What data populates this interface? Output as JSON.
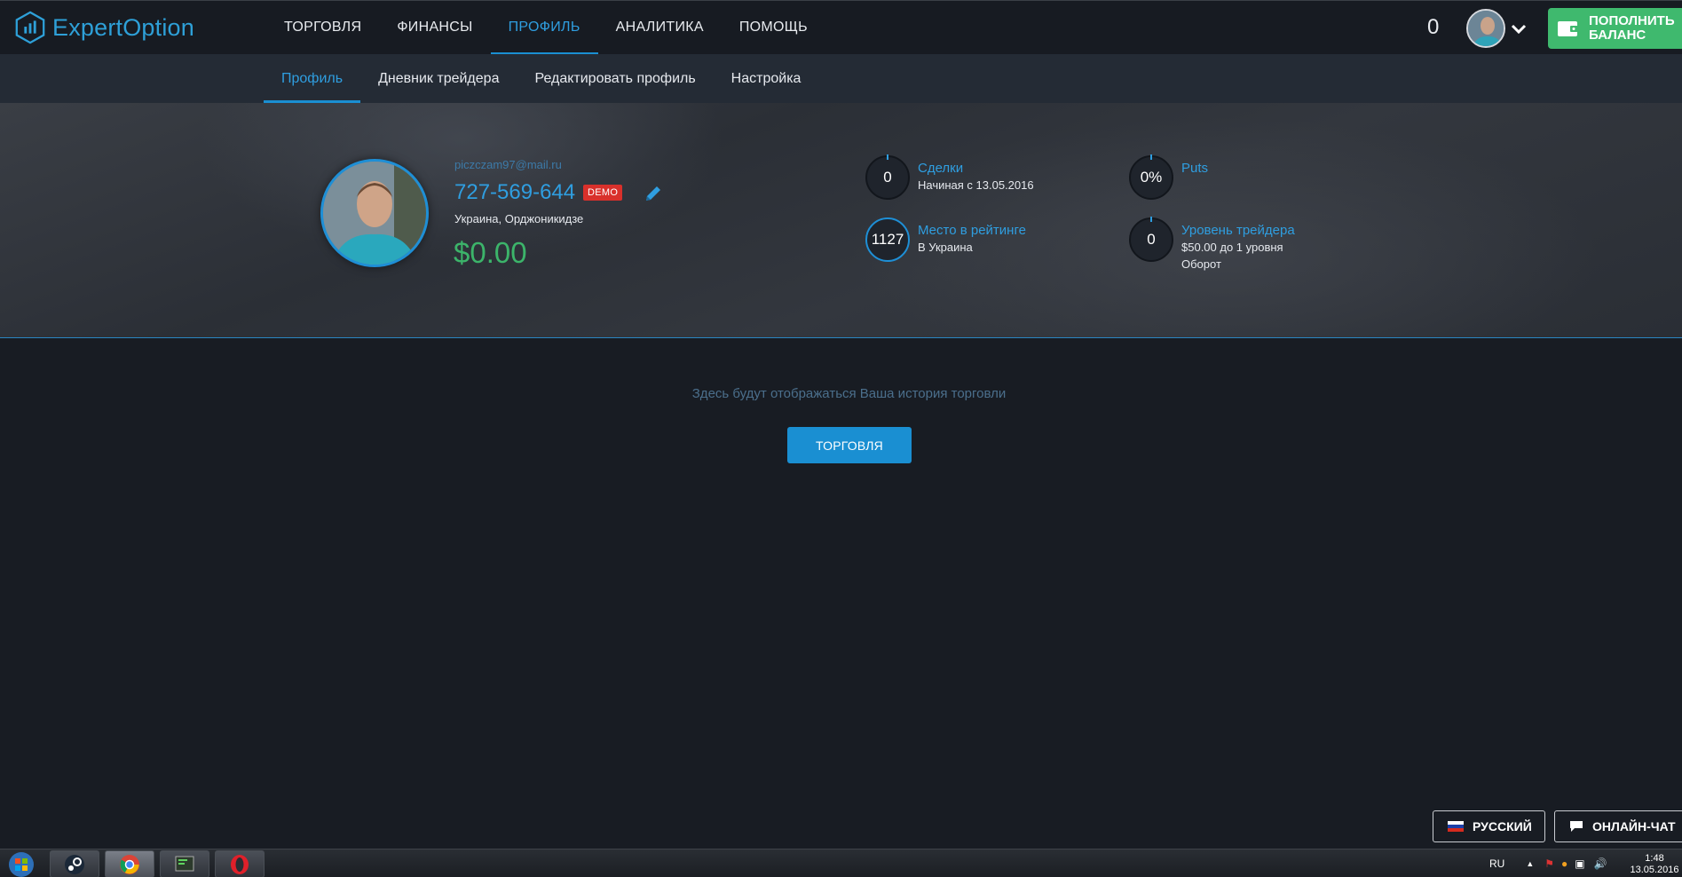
{
  "app": {
    "brand": "ExpertOption",
    "accent": "#1a8fd2",
    "success": "#3cb46a",
    "danger": "#d9302b"
  },
  "header": {
    "nav": [
      {
        "label": "ТОРГОВЛЯ"
      },
      {
        "label": "ФИНАНСЫ"
      },
      {
        "label": "ПРОФИЛЬ"
      },
      {
        "label": "АНАЛИТИКА"
      },
      {
        "label": "ПОМОЩЬ"
      }
    ],
    "active_nav": "ПРОФИЛЬ",
    "notifications": "0",
    "deposit_line1": "ПОПОЛНИТЬ",
    "deposit_line2": "БАЛАНС"
  },
  "subnav": {
    "items": [
      {
        "label": "Профиль"
      },
      {
        "label": "Дневник трейдера"
      },
      {
        "label": "Редактировать профиль"
      },
      {
        "label": "Настройка"
      }
    ],
    "active": "Профиль"
  },
  "profile": {
    "email": "piczczam97@mail.ru",
    "id": "727-569-644",
    "badge": "DEMO",
    "location": "Украина, Орджоникидзе",
    "balance": "$0.00"
  },
  "stats": {
    "deals": {
      "value": "0",
      "label": "Сделки",
      "sub": "Начиная с 13.05.2016"
    },
    "puts": {
      "value": "0%",
      "label": "Puts"
    },
    "rank": {
      "value": "1127",
      "label": "Место в рейтинге",
      "sub": "В Украина"
    },
    "level": {
      "value": "0",
      "label": "Уровень трейдера",
      "sub": "$50.00 до 1 уровня",
      "sub2": "Оборот"
    }
  },
  "history": {
    "empty_text": "Здесь будут отображаться Ваша история торговли",
    "trade_button": "ТОРГОВЛЯ"
  },
  "footer": {
    "language": "РУССКИЙ",
    "chat": "ОНЛАЙН-ЧАТ"
  },
  "taskbar": {
    "lang": "RU",
    "time": "1:48",
    "date": "13.05.2016"
  }
}
